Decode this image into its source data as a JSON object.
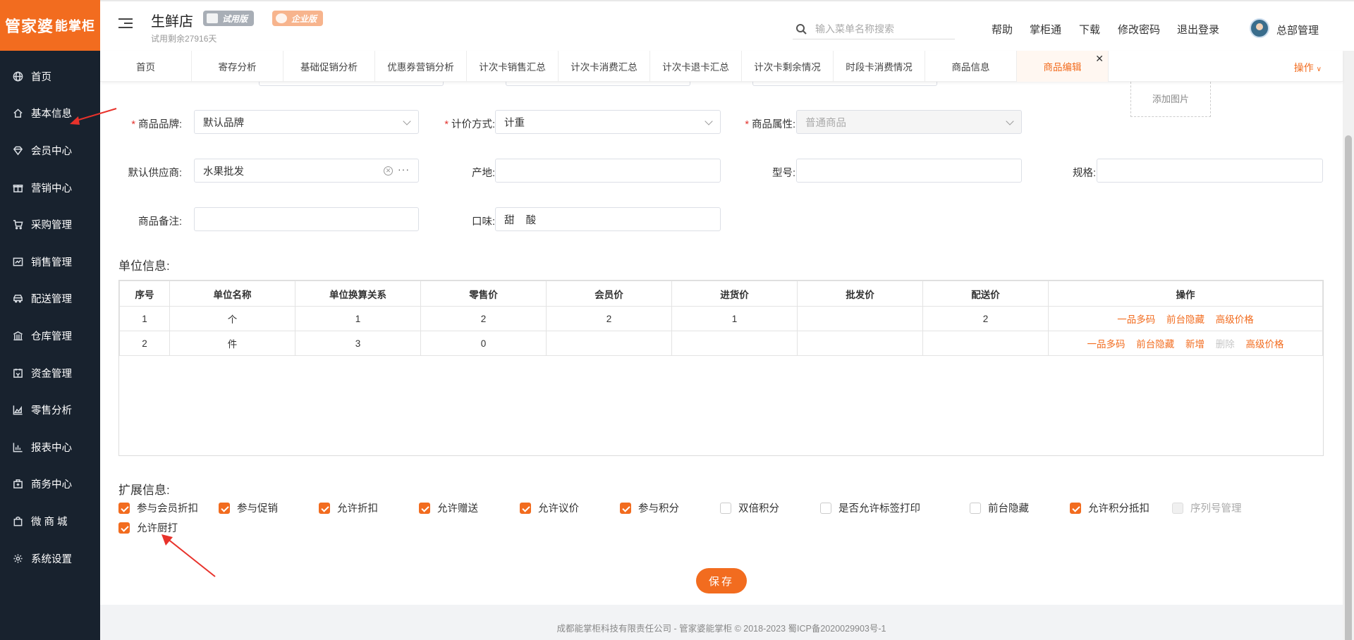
{
  "logo": {
    "main": "管家婆",
    "sub": "能掌柜"
  },
  "sidebar": {
    "items": [
      {
        "label": "首页",
        "icon": "globe-icon"
      },
      {
        "label": "基本信息",
        "icon": "home-icon"
      },
      {
        "label": "会员中心",
        "icon": "diamond-icon"
      },
      {
        "label": "营销中心",
        "icon": "gift-icon"
      },
      {
        "label": "采购管理",
        "icon": "cart-icon"
      },
      {
        "label": "销售管理",
        "icon": "sales-icon"
      },
      {
        "label": "配送管理",
        "icon": "car-icon"
      },
      {
        "label": "仓库管理",
        "icon": "warehouse-icon"
      },
      {
        "label": "资金管理",
        "icon": "wallet-icon"
      },
      {
        "label": "零售分析",
        "icon": "area-chart-icon"
      },
      {
        "label": "报表中心",
        "icon": "bar-chart-icon"
      },
      {
        "label": "商务中心",
        "icon": "briefcase-icon"
      },
      {
        "label": "微 商 城",
        "icon": "bag-icon"
      },
      {
        "label": "系统设置",
        "icon": "gear-icon"
      }
    ]
  },
  "header": {
    "shop_name": "生鲜店",
    "trial_days": "试用剩余27916天",
    "badge_trial": "试用版",
    "badge_enterprise": "企业版",
    "search_placeholder": "输入菜单名称搜索",
    "links": [
      "帮助",
      "掌柜通",
      "下载",
      "修改密码",
      "退出登录"
    ],
    "user": "总部管理"
  },
  "tabs": {
    "items": [
      "首页",
      "寄存分析",
      "基础促销分析",
      "优惠券营销分析",
      "计次卡销售汇总",
      "计次卡消费汇总",
      "计次卡退卡汇总",
      "计次卡剩余情况",
      "时段卡消费情况",
      "商品信息",
      "商品编辑"
    ],
    "active_index": 10,
    "ops_label": "操作"
  },
  "form": {
    "upload_label": "添加图片",
    "brand": {
      "label": "商品品牌",
      "value": "默认品牌"
    },
    "pricing": {
      "label": "计价方式",
      "value": "计重"
    },
    "attr": {
      "label": "商品属性",
      "value": "普通商品"
    },
    "supplier": {
      "label": "默认供应商",
      "value": "水果批发"
    },
    "origin": {
      "label": "产地",
      "value": ""
    },
    "model": {
      "label": "型号",
      "value": ""
    },
    "spec": {
      "label": "规格",
      "value": ""
    },
    "remark": {
      "label": "商品备注",
      "value": ""
    },
    "taste": {
      "label": "口味",
      "value": "甜    酸"
    }
  },
  "units": {
    "title": "单位信息:",
    "columns": [
      "序号",
      "单位名称",
      "单位换算关系",
      "零售价",
      "会员价",
      "进货价",
      "批发价",
      "配送价",
      "操作"
    ],
    "rows": [
      {
        "no": "1",
        "name": "个",
        "ratio": "1",
        "retail": "2",
        "member": "2",
        "purchase": "1",
        "wholesale": "",
        "delivery": "2",
        "ops": [
          "一品多码",
          "前台隐藏",
          "高级价格"
        ]
      },
      {
        "no": "2",
        "name": "件",
        "ratio": "3",
        "retail": "0",
        "member": "",
        "purchase": "",
        "wholesale": "",
        "delivery": "",
        "ops": [
          "一品多码",
          "前台隐藏",
          "新增",
          "删除",
          "高级价格"
        ]
      }
    ]
  },
  "extend": {
    "title": "扩展信息:",
    "options": [
      {
        "label": "参与会员折扣",
        "checked": true
      },
      {
        "label": "参与促销",
        "checked": true
      },
      {
        "label": "允许折扣",
        "checked": true
      },
      {
        "label": "允许赠送",
        "checked": true
      },
      {
        "label": "允许议价",
        "checked": true
      },
      {
        "label": "参与积分",
        "checked": true
      },
      {
        "label": "双倍积分",
        "checked": false
      },
      {
        "label": "是否允许标签打印",
        "checked": false
      },
      {
        "label": "前台隐藏",
        "checked": false
      },
      {
        "label": "允许积分抵扣",
        "checked": true
      },
      {
        "label": "序列号管理",
        "checked": false,
        "disabled": true
      },
      {
        "label": "允许厨打",
        "checked": true
      }
    ]
  },
  "save_label": "保存",
  "footer": "成都能掌柜科技有限责任公司 - 管家婆能掌柜 © 2018-2023 蜀ICP备2020029903号-1",
  "colors": {
    "accent": "#f26c1f",
    "sidebar": "#18222e",
    "annotation": "#e8322b"
  }
}
